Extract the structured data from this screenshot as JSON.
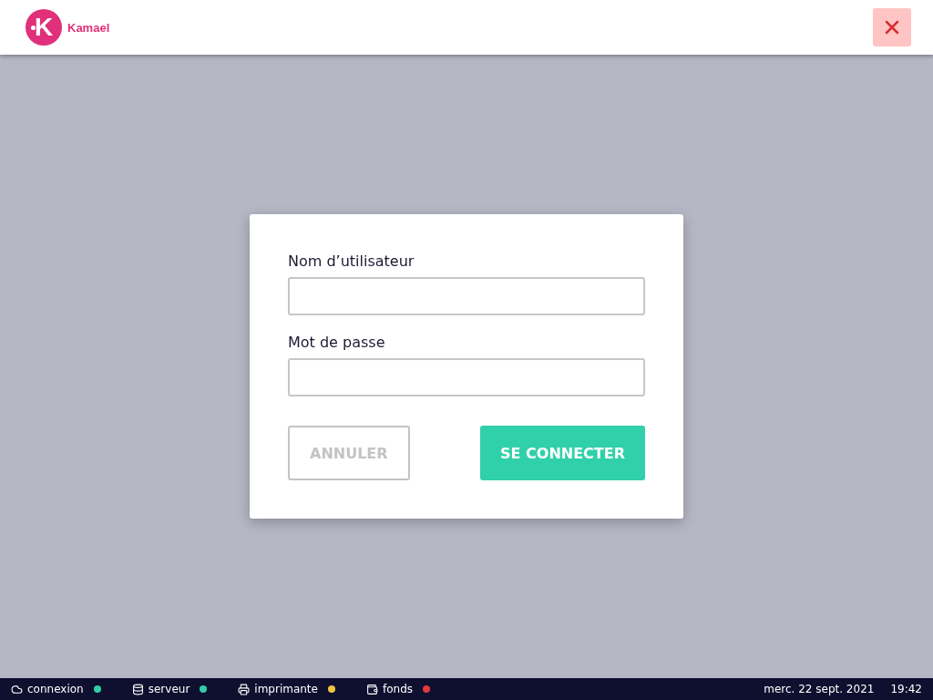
{
  "header": {
    "logo": {
      "letter": "K",
      "name": "Kamael"
    }
  },
  "login": {
    "fields": [
      {
        "label": "Nom d’utilisateur"
      },
      {
        "label": "Mot de passe"
      }
    ],
    "cancel": {
      "label": "ANNULER",
      "disabled": true
    },
    "submit": {
      "label": "SE CONNECTER",
      "disabled": false
    }
  },
  "status_bar": {
    "items": [
      {
        "kind": "cloud",
        "label": "connexion",
        "color": "#2ecfa8"
      },
      {
        "kind": "database",
        "label": "serveur",
        "color": "#2ecfa8"
      },
      {
        "kind": "printer",
        "label": "imprimante",
        "color": "#f2c53d"
      },
      {
        "kind": "wallet",
        "label": "fonds",
        "color": "#e03a3a"
      }
    ],
    "date": "merc. 22 sept. 2021",
    "time": "19:42"
  }
}
